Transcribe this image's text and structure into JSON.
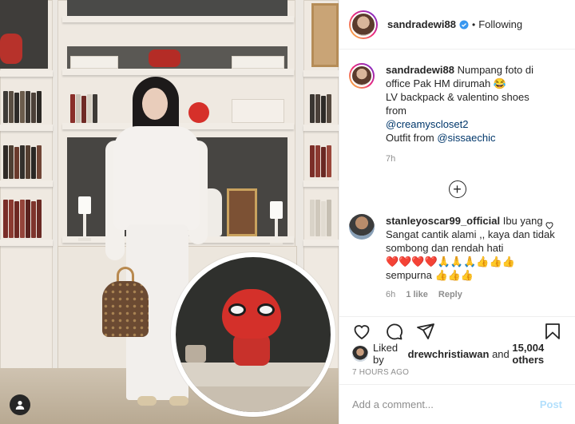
{
  "header": {
    "username": "sandradewi88",
    "follow_status": "Following",
    "dot": "•"
  },
  "caption": {
    "username": "sandradewi88",
    "line1": "Numpang foto di office Pak HM dirumah 😂",
    "line2": "LV backpack & valentino shoes from",
    "mention1": "@creamyscloset2",
    "line3": "Outfit from",
    "mention2": "@sissaechic",
    "time": "7h"
  },
  "comments": [
    {
      "username": "stanleyoscar99_official",
      "text": "Ibu yang Sangat cantik alami ,, kaya dan tidak sombong dan rendah hati",
      "emoji1": "❤️❤️❤️❤️🙏🙏🙏👍👍👍",
      "text2": "sempurna",
      "emoji2": "👍👍👍",
      "time": "6h",
      "likes": "1 like",
      "reply": "Reply"
    }
  ],
  "likes": {
    "prefix": "Liked by",
    "user": "drewchristiawan",
    "and": "and",
    "others": "15,004 others"
  },
  "posted_ago": "7 HOURS AGO",
  "add_comment": {
    "placeholder": "Add a comment...",
    "post_label": "Post"
  },
  "icons": {
    "verified": "verified-badge-icon",
    "heart": "heart-icon",
    "comment": "comment-icon",
    "share": "share-icon",
    "save": "bookmark-icon",
    "add": "plus-circle-icon",
    "user_tag": "user-tag-icon"
  },
  "colors": {
    "link": "#00376b",
    "verified": "#3897f0",
    "post_disabled": "#b2dffc"
  }
}
